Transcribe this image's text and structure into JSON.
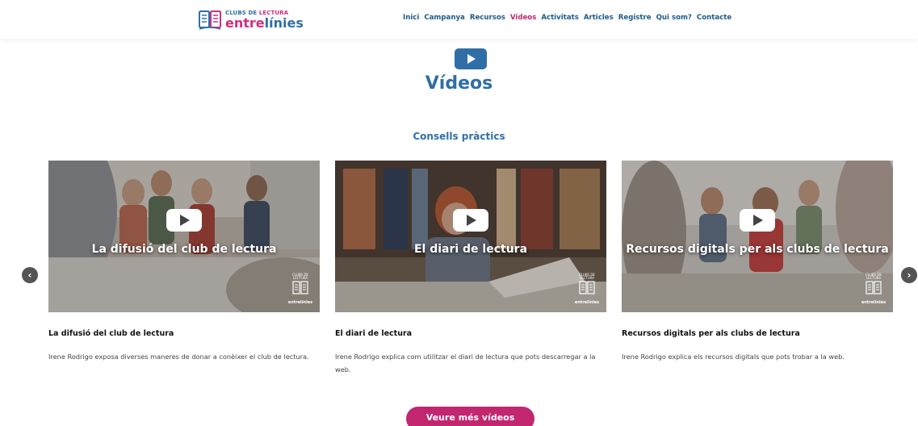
{
  "header": {
    "logo": {
      "small_left": "CLUBS DE ",
      "small_right": "LECTURA",
      "big_left": "entre",
      "big_right": "línies"
    },
    "nav": [
      {
        "label": "Inici"
      },
      {
        "label": "Campanya"
      },
      {
        "label": "Recursos"
      },
      {
        "label": "Videos",
        "active": true
      },
      {
        "label": "Activitats"
      },
      {
        "label": "Articles"
      },
      {
        "label": "Registre"
      },
      {
        "label": "Qui som?"
      },
      {
        "label": "Contacte"
      }
    ]
  },
  "main": {
    "title_icon": "play-icon",
    "title": "Vídeos",
    "section_title": "Consells pràctics",
    "carousel": {
      "prev_icon": "chevron-left-icon",
      "next_icon": "chevron-right-icon",
      "cards": [
        {
          "overlay": "La difusió del club de lectura",
          "title": "La difusió del club de lectura",
          "description": "Irene Rodrigo exposa diverses maneres de donar a conèixer el club de lectura.",
          "watermark_small": "CLUBS DE LECTURA",
          "watermark": "entrelínies"
        },
        {
          "overlay": "El diari de lectura",
          "title": "El diari de lectura",
          "description": "Irene Rodrigo explica com utilitzar el diari de lectura que pots descarregar a la web.",
          "watermark_small": "CLUBS DE LECTURA",
          "watermark": "entrelínies"
        },
        {
          "overlay": "Recursos digitals per als clubs de lectura",
          "title": "Recursos digitals per als clubs de lectura",
          "description": "Irene Rodrigo explica els recursos digitals que pots trobar a la web.",
          "watermark_small": "CLUBS DE LECTURA",
          "watermark": "entrelínies"
        }
      ]
    },
    "cta": "Veure més vídeos"
  },
  "colors": {
    "brand_blue": "#2f6fa6",
    "brand_pink": "#c2266f"
  }
}
